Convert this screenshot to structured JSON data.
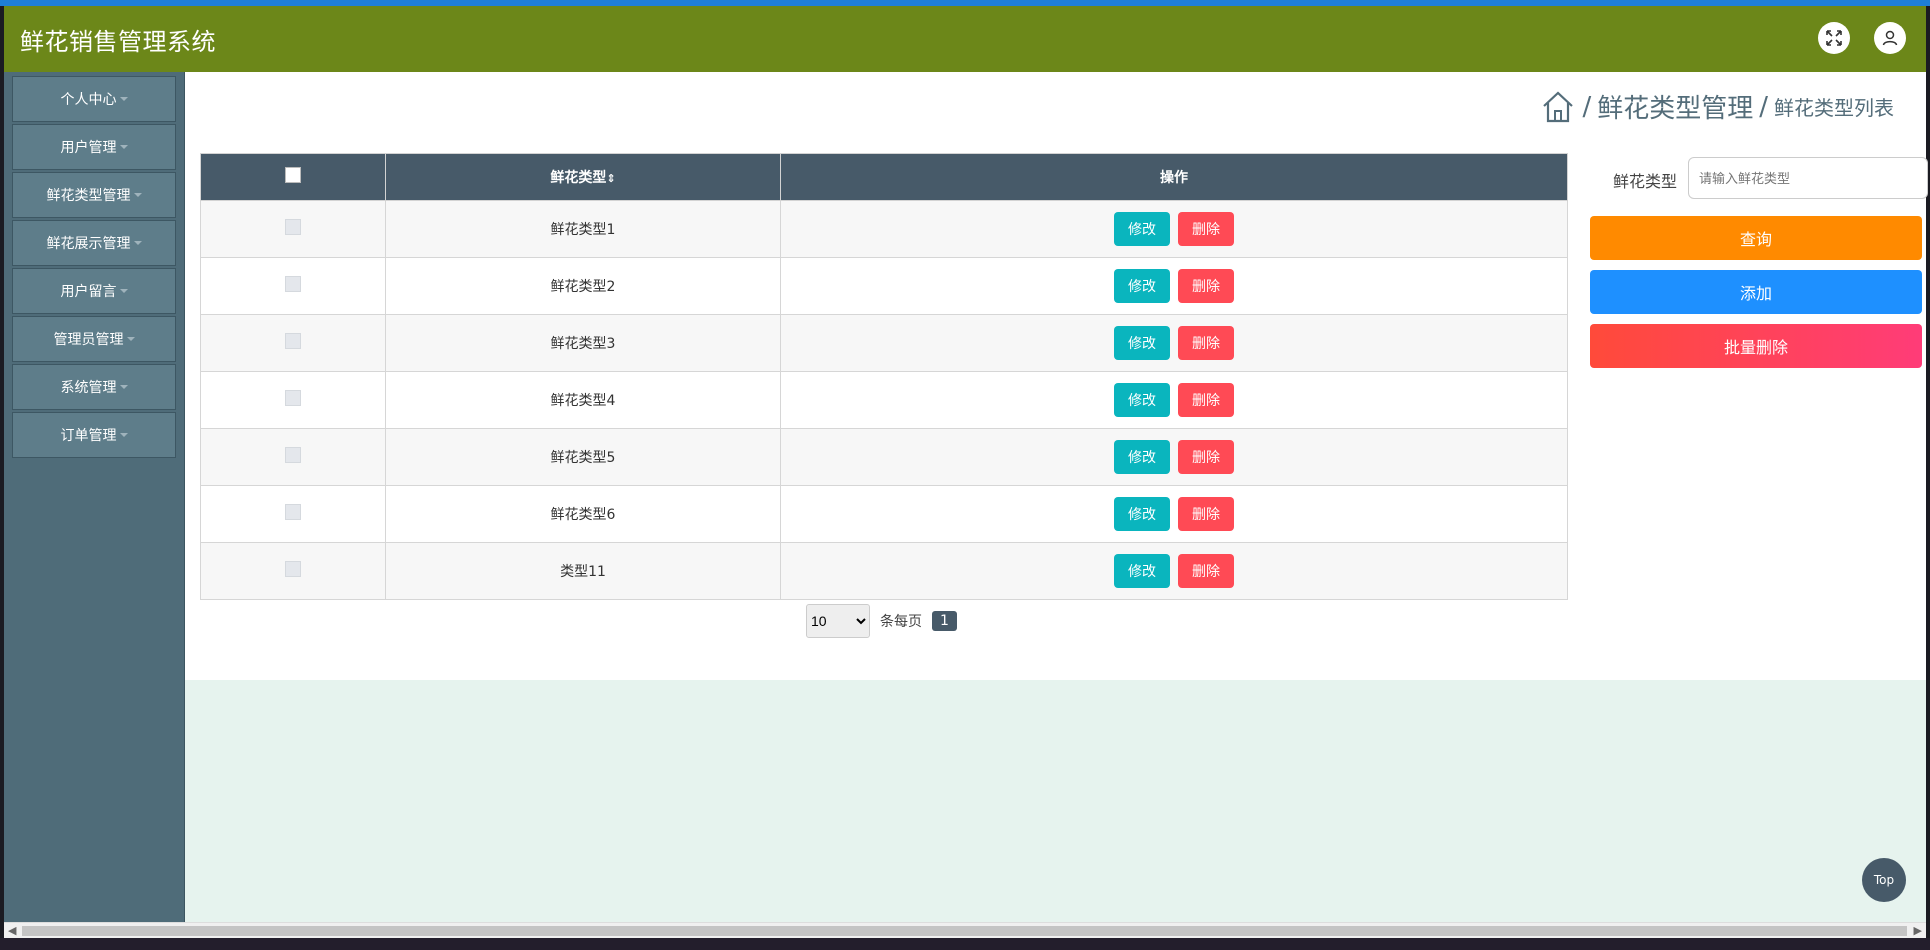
{
  "header": {
    "title": "鲜花销售管理系统"
  },
  "icons": {
    "fullscreen": "expand-arrows-icon",
    "user": "user-icon",
    "home": "home-icon"
  },
  "sidebar": {
    "items": [
      {
        "label": "个人中心"
      },
      {
        "label": "用户管理"
      },
      {
        "label": "鲜花类型管理"
      },
      {
        "label": "鲜花展示管理"
      },
      {
        "label": "用户留言"
      },
      {
        "label": "管理员管理"
      },
      {
        "label": "系统管理"
      },
      {
        "label": "订单管理"
      }
    ]
  },
  "breadcrumb": {
    "section": "鲜花类型管理",
    "page": "鲜花类型列表",
    "separator": "/"
  },
  "table": {
    "headers": {
      "type": "鲜花类型",
      "sort_glyph": "⇕",
      "actions": "操作"
    },
    "edit_label": "修改",
    "delete_label": "删除",
    "rows": [
      {
        "type": "鲜花类型1"
      },
      {
        "type": "鲜花类型2"
      },
      {
        "type": "鲜花类型3"
      },
      {
        "type": "鲜花类型4"
      },
      {
        "type": "鲜花类型5"
      },
      {
        "type": "鲜花类型6"
      },
      {
        "type": "类型11"
      }
    ]
  },
  "pagination": {
    "page_size": "10",
    "per_page_label": "条每页",
    "current_page": "1"
  },
  "search": {
    "label": "鲜花类型",
    "placeholder": "请输入鲜花类型",
    "value": ""
  },
  "actions": {
    "query": "查询",
    "add": "添加",
    "batch_delete": "批量删除"
  },
  "back_to_top": "Top",
  "colors": {
    "header": "#6c8719",
    "sidebar": "#4f6c79",
    "table_header": "#475a69",
    "query": "#ff8a00",
    "add": "#1e90ff",
    "delete": "#ff4a55",
    "edit": "#0ab5be"
  }
}
